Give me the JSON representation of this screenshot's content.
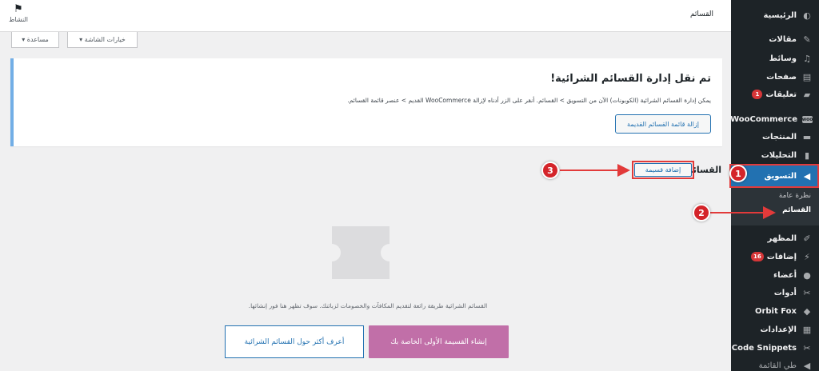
{
  "topbar": {
    "title": "القسائم",
    "activity_label": "النشاط"
  },
  "tabs": {
    "help": "مساعدة ▾",
    "screen_options": "خيارات الشاشة ▾"
  },
  "notice": {
    "title": "تم نقل إدارة القسائم الشرائية!",
    "description": "يمكن إدارة القسائم الشرائية (الكوبونات) الآن من التسويق > القسائم. أنقر على الزر أدناه لإزالة WooCommerce القديم > عنصر قائمة القسائم.",
    "button": "إزالة قائمة القسائم القديمة"
  },
  "page": {
    "heading": "القسائم",
    "add_button": "إضافة قسيمة"
  },
  "empty_state": {
    "text": "القسائم الشرائية طريقة رائعة لتقديم المكافآت والخصومات لزبائنك. سوف تظهر هنا فور إنشائها.",
    "primary_button": "إنشاء القسيمة الأولى الخاصة بك",
    "secondary_button": "أعرف أكثر حول القسائم الشرائية"
  },
  "sidebar": {
    "items": [
      {
        "label": "الرئيسية",
        "icon": "dashboard-icon"
      },
      {
        "label": "مقالات",
        "icon": "pin-icon"
      },
      {
        "label": "وسائط",
        "icon": "media-icon"
      },
      {
        "label": "صفحات",
        "icon": "page-icon"
      },
      {
        "label": "تعليقات",
        "icon": "comment-icon",
        "badge": "1"
      },
      {
        "label": "WooCommerce",
        "icon": "woo-icon"
      },
      {
        "label": "المنتجات",
        "icon": "archive-icon"
      },
      {
        "label": "التحليلات",
        "icon": "chart-icon"
      },
      {
        "label": "التسويق",
        "icon": "megaphone-icon"
      },
      {
        "label": "المظهر",
        "icon": "brush-icon"
      },
      {
        "label": "إضافات",
        "icon": "plugin-icon",
        "badge": "16"
      },
      {
        "label": "أعضاء",
        "icon": "user-icon"
      },
      {
        "label": "أدوات",
        "icon": "wrench-icon"
      },
      {
        "label": "Orbit Fox",
        "icon": "fox-icon"
      },
      {
        "label": "الإعدادات",
        "icon": "settings-icon"
      },
      {
        "label": "Code Snippets",
        "icon": "code-icon"
      },
      {
        "label": "طي القائمة",
        "icon": "collapse-icon"
      }
    ],
    "submenu": {
      "overview": "نظرة عامة",
      "coupons": "القسائم"
    }
  },
  "annotations": {
    "one": "1",
    "two": "2",
    "three": "3"
  },
  "colors": {
    "sidebar_bg": "#1d2327",
    "accent": "#2271b1",
    "primary_button": "#c16fa8",
    "annotation": "#d4242a"
  }
}
